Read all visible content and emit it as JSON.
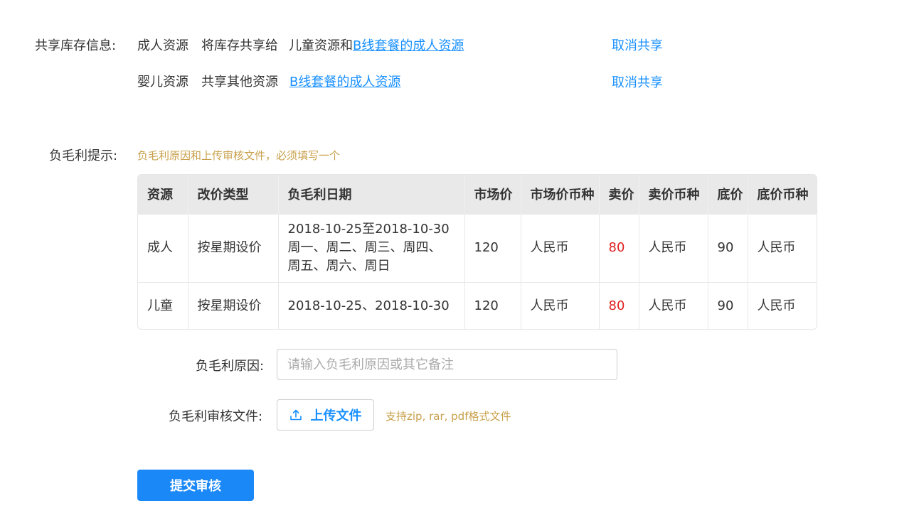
{
  "share": {
    "label": "共享库存信息:",
    "row1": {
      "resource": "成人资源",
      "action_text": "将库存共享给",
      "targets_prefix": "儿童资源和",
      "target_link": "B线套餐的成人资源",
      "cancel": "取消共享"
    },
    "row2": {
      "resource": "婴儿资源",
      "action_text": "共享其他资源",
      "target_link": "B线套餐的成人资源",
      "cancel": "取消共享"
    }
  },
  "margin": {
    "label": "负毛利提示:",
    "hint": "负毛利原因和上传审核文件，必须填写一个"
  },
  "table": {
    "headers": [
      "资源",
      "改价类型",
      "负毛利日期",
      "市场价",
      "市场价币种",
      "卖价",
      "卖价币种",
      "底价",
      "底价币种"
    ],
    "rows": [
      {
        "resource": "成人",
        "type": "按星期设价",
        "date_line1": "2018-10-25至2018-10-30",
        "date_line2": "周一、周二、周三、周四、",
        "date_line3": "周五、周六、周日",
        "market_price": "120",
        "market_currency": "人民币",
        "sell_price": "80",
        "sell_currency": "人民币",
        "floor_price": "90",
        "floor_currency": "人民币"
      },
      {
        "resource": "儿童",
        "type": "按星期设价",
        "date_line1": "2018-10-25、2018-10-30",
        "market_price": "120",
        "market_currency": "人民币",
        "sell_price": "80",
        "sell_currency": "人民币",
        "floor_price": "90",
        "floor_currency": "人民币"
      }
    ]
  },
  "form": {
    "reason_label": "负毛利原因:",
    "reason_placeholder": "请输入负毛利原因或其它备注",
    "file_label": "负毛利审核文件:",
    "upload_label": "上传文件",
    "upload_hint": "支持zip, rar, pdf格式文件",
    "submit_label": "提交审核"
  },
  "colors": {
    "accent": "#1890ff",
    "hint": "#c8a04a",
    "negative_price": "#e02020"
  }
}
